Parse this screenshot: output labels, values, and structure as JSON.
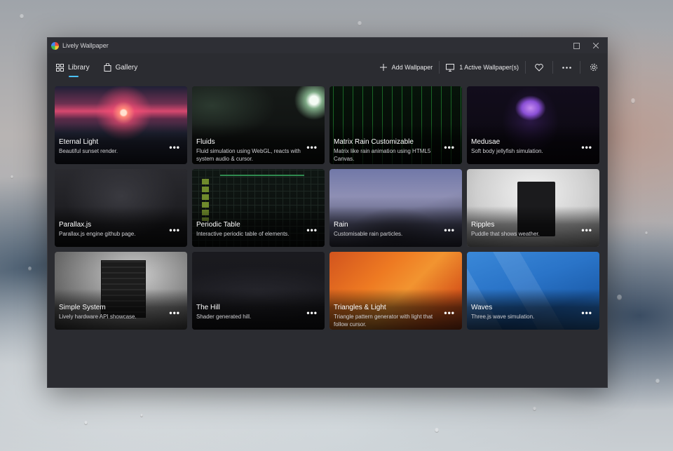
{
  "window": {
    "title": "Lively Wallpaper"
  },
  "nav": {
    "tabs": [
      {
        "label": "Library",
        "icon": "grid-icon",
        "active": true
      },
      {
        "label": "Gallery",
        "icon": "bag-icon",
        "active": false
      }
    ],
    "add_wallpaper": "Add Wallpaper",
    "active_wallpapers": "1 Active Wallpaper(s)"
  },
  "cards": [
    {
      "name": "Eternal Light",
      "desc": "Beautiful sunset render."
    },
    {
      "name": "Fluids",
      "desc": "Fluid simulation using WebGL, reacts with system audio & cursor."
    },
    {
      "name": "Matrix Rain Customizable",
      "desc": "Matrix like rain animation using HTML5 Canvas."
    },
    {
      "name": "Medusae",
      "desc": "Soft body jellyfish simulation."
    },
    {
      "name": "Parallax.js",
      "desc": "Parallax.js engine github page."
    },
    {
      "name": "Periodic Table",
      "desc": "Interactive periodic table of elements."
    },
    {
      "name": "Rain",
      "desc": "Customisable rain particles."
    },
    {
      "name": "Ripples",
      "desc": "Puddle that shows weather."
    },
    {
      "name": "Simple System",
      "desc": "Lively hardware API showcase."
    },
    {
      "name": "The Hill",
      "desc": "Shader generated hill."
    },
    {
      "name": "Triangles & Light",
      "desc": "Triangle pattern generator with light that follow cursor."
    },
    {
      "name": "Waves",
      "desc": "Three.js wave simulation."
    }
  ],
  "card_more_label": "•••",
  "colors": {
    "accent": "#4cc2ff",
    "window_bg": "#2b2c31"
  }
}
